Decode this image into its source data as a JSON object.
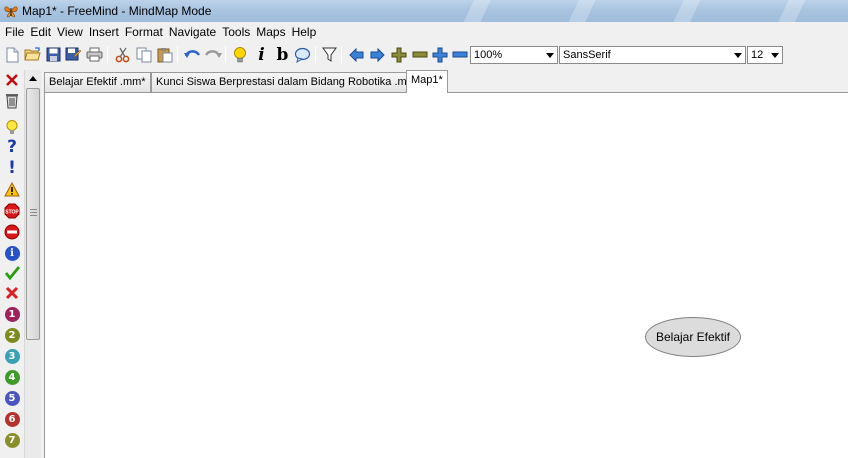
{
  "window": {
    "title": "Map1* - FreeMind - MindMap Mode",
    "app_icon": "butterfly-icon"
  },
  "menu": [
    "File",
    "Edit",
    "View",
    "Insert",
    "Format",
    "Navigate",
    "Tools",
    "Maps",
    "Help"
  ],
  "toolbar": {
    "zoom": "100%",
    "font_family": "SansSerif",
    "font_size": "12",
    "icons": [
      "new-icon",
      "open-icon",
      "save-icon",
      "save-as-icon",
      "print-icon",
      "cut-icon",
      "copy-icon",
      "paste-icon",
      "undo-icon",
      "redo-icon",
      "lightbulb-icon",
      "italic-icon",
      "bold-icon",
      "note-icon",
      "filter-icon",
      "back-icon",
      "forward-icon",
      "add-node-icon",
      "remove-node-icon",
      "zoom-in-icon",
      "zoom-out-icon"
    ],
    "italic_glyph": "i",
    "bold_glyph": "b"
  },
  "icon_panel": {
    "icons": [
      "remove-icon-x",
      "trash-icon",
      "idea-icon",
      "question-icon",
      "important-icon",
      "warning-icon",
      "stop-icon",
      "stop-sign-icon",
      "info-icon",
      "ok-icon",
      "not-ok-icon",
      "priority-1-icon",
      "priority-2-icon",
      "priority-3-icon",
      "priority-4-icon",
      "priority-5-icon",
      "priority-6-icon",
      "priority-7-icon"
    ],
    "priority_numbers": [
      "1",
      "2",
      "3",
      "4",
      "5",
      "6",
      "7"
    ],
    "stop_text": "STOP",
    "question_glyph": "?",
    "exclaim_glyph": "!",
    "info_glyph": "i"
  },
  "tabs": [
    {
      "label": "Belajar Efektif .mm*",
      "active": false
    },
    {
      "label": "Kunci Siswa Berprestasi dalam Bidang Robotika .mm",
      "active": false
    },
    {
      "label": "Map1*",
      "active": true
    }
  ],
  "map": {
    "root_node": "Belajar Efektif"
  },
  "colors": {
    "titlebar": "#a9c4e0",
    "node_fill": "#dcdcdc",
    "priority": [
      "#a0225d",
      "#7c8a1e",
      "#3aa0b5",
      "#3e9a2a",
      "#4a55c0",
      "#b3332a",
      "#8a8f2c"
    ]
  }
}
